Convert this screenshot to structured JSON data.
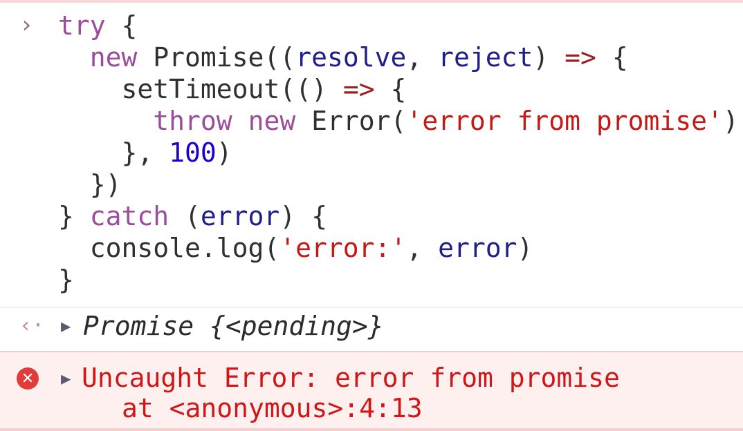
{
  "console": {
    "prompt_icon": "›",
    "code_lines": [
      {
        "tokens": [
          {
            "t": "try",
            "c": "kw"
          },
          {
            "t": " {",
            "c": "plain"
          }
        ]
      },
      {
        "tokens": [
          {
            "t": "  ",
            "c": "plain"
          },
          {
            "t": "new",
            "c": "kw"
          },
          {
            "t": " Promise((",
            "c": "plain"
          },
          {
            "t": "resolve",
            "c": "var"
          },
          {
            "t": ", ",
            "c": "plain"
          },
          {
            "t": "reject",
            "c": "var"
          },
          {
            "t": ") ",
            "c": "plain"
          },
          {
            "t": "=>",
            "c": "arrow"
          },
          {
            "t": " {",
            "c": "plain"
          }
        ]
      },
      {
        "tokens": [
          {
            "t": "    setTimeout(() ",
            "c": "plain"
          },
          {
            "t": "=>",
            "c": "arrow"
          },
          {
            "t": " {",
            "c": "plain"
          }
        ]
      },
      {
        "tokens": [
          {
            "t": "      ",
            "c": "plain"
          },
          {
            "t": "throw",
            "c": "kw"
          },
          {
            "t": " ",
            "c": "plain"
          },
          {
            "t": "new",
            "c": "kw"
          },
          {
            "t": " Error(",
            "c": "plain"
          },
          {
            "t": "'error from promise'",
            "c": "str"
          },
          {
            "t": ")",
            "c": "plain"
          }
        ]
      },
      {
        "tokens": [
          {
            "t": "    }, ",
            "c": "plain"
          },
          {
            "t": "100",
            "c": "num"
          },
          {
            "t": ")",
            "c": "plain"
          }
        ]
      },
      {
        "tokens": [
          {
            "t": "  })",
            "c": "plain"
          }
        ]
      },
      {
        "tokens": [
          {
            "t": "} ",
            "c": "plain"
          },
          {
            "t": "catch",
            "c": "kw"
          },
          {
            "t": " (",
            "c": "plain"
          },
          {
            "t": "error",
            "c": "var"
          },
          {
            "t": ") {",
            "c": "plain"
          }
        ]
      },
      {
        "tokens": [
          {
            "t": "  console.log(",
            "c": "plain"
          },
          {
            "t": "'error:'",
            "c": "str"
          },
          {
            "t": ", ",
            "c": "plain"
          },
          {
            "t": "error",
            "c": "var"
          },
          {
            "t": ")",
            "c": "plain"
          }
        ]
      },
      {
        "tokens": [
          {
            "t": "}",
            "c": "plain"
          }
        ]
      }
    ],
    "result": {
      "return_icon": "‹·",
      "expand_icon": "▶",
      "text": "Promise {<pending>}"
    },
    "error": {
      "icon_glyph": "✕",
      "expand_icon": "▶",
      "message": "Uncaught Error: error from promise",
      "stack": "at <anonymous>:4:13",
      "color": "#d01616"
    }
  }
}
